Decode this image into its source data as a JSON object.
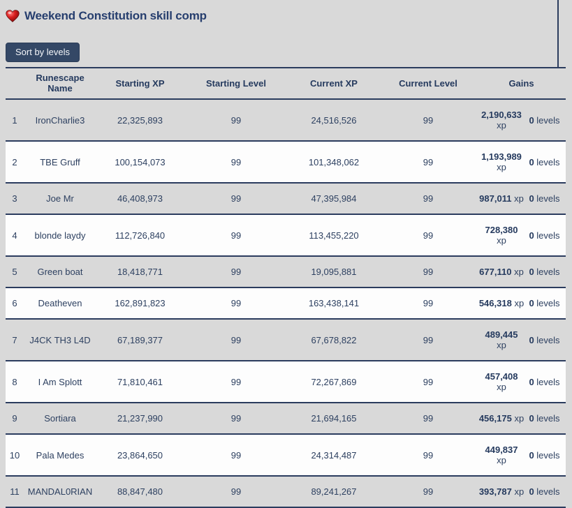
{
  "page": {
    "title": "Weekend Constitution skill comp",
    "heart_icon": "glossy-red-heart",
    "sort_button_label": "Sort by levels",
    "colors": {
      "background": "#d9d9d9",
      "row_alt": "#fdfdfd",
      "navy_line": "#2b3c5e",
      "title_text": "#263e6e",
      "button_bg": "#344866",
      "heart_red": "#c41414"
    }
  },
  "table": {
    "columns": {
      "rank": "",
      "name": "Runescape Name",
      "starting_xp": "Starting XP",
      "starting_level": "Starting Level",
      "current_xp": "Current XP",
      "current_level": "Current Level",
      "gains": "Gains"
    },
    "rows": [
      {
        "rank": "1",
        "name": "IronCharlie3",
        "starting_xp": "22,325,893",
        "starting_level": "99",
        "current_xp": "24,516,526",
        "current_level": "99",
        "gain_xp": "2,190,633",
        "gain_xp_unit": "xp",
        "gain_xp_wrap": true,
        "gain_levels": "0",
        "gain_levels_unit": "levels"
      },
      {
        "rank": "2",
        "name": "TBE Gruff",
        "starting_xp": "100,154,073",
        "starting_level": "99",
        "current_xp": "101,348,062",
        "current_level": "99",
        "gain_xp": "1,193,989",
        "gain_xp_unit": "xp",
        "gain_xp_wrap": true,
        "gain_levels": "0",
        "gain_levels_unit": "levels"
      },
      {
        "rank": "3",
        "name": "Joe Mr",
        "starting_xp": "46,408,973",
        "starting_level": "99",
        "current_xp": "47,395,984",
        "current_level": "99",
        "gain_xp": "987,011",
        "gain_xp_unit": "xp",
        "gain_xp_wrap": false,
        "gain_levels": "0",
        "gain_levels_unit": "levels"
      },
      {
        "rank": "4",
        "name": "blonde laydy",
        "starting_xp": "112,726,840",
        "starting_level": "99",
        "current_xp": "113,455,220",
        "current_level": "99",
        "gain_xp": "728,380",
        "gain_xp_unit": "xp",
        "gain_xp_wrap": true,
        "gain_levels": "0",
        "gain_levels_unit": "levels"
      },
      {
        "rank": "5",
        "name": "Green boat",
        "starting_xp": "18,418,771",
        "starting_level": "99",
        "current_xp": "19,095,881",
        "current_level": "99",
        "gain_xp": "677,110",
        "gain_xp_unit": "xp",
        "gain_xp_wrap": false,
        "gain_levels": "0",
        "gain_levels_unit": "levels"
      },
      {
        "rank": "6",
        "name": "Deatheven",
        "starting_xp": "162,891,823",
        "starting_level": "99",
        "current_xp": "163,438,141",
        "current_level": "99",
        "gain_xp": "546,318",
        "gain_xp_unit": "xp",
        "gain_xp_wrap": false,
        "gain_levels": "0",
        "gain_levels_unit": "levels"
      },
      {
        "rank": "7",
        "name": "J4CK TH3 L4D",
        "starting_xp": "67,189,377",
        "starting_level": "99",
        "current_xp": "67,678,822",
        "current_level": "99",
        "gain_xp": "489,445",
        "gain_xp_unit": "xp",
        "gain_xp_wrap": true,
        "gain_levels": "0",
        "gain_levels_unit": "levels"
      },
      {
        "rank": "8",
        "name": "I Am Splott",
        "starting_xp": "71,810,461",
        "starting_level": "99",
        "current_xp": "72,267,869",
        "current_level": "99",
        "gain_xp": "457,408",
        "gain_xp_unit": "xp",
        "gain_xp_wrap": true,
        "gain_levels": "0",
        "gain_levels_unit": "levels"
      },
      {
        "rank": "9",
        "name": "Sortiara",
        "starting_xp": "21,237,990",
        "starting_level": "99",
        "current_xp": "21,694,165",
        "current_level": "99",
        "gain_xp": "456,175",
        "gain_xp_unit": "xp",
        "gain_xp_wrap": false,
        "gain_levels": "0",
        "gain_levels_unit": "levels"
      },
      {
        "rank": "10",
        "name": "Pala Medes",
        "starting_xp": "23,864,650",
        "starting_level": "99",
        "current_xp": "24,314,487",
        "current_level": "99",
        "gain_xp": "449,837",
        "gain_xp_unit": "xp",
        "gain_xp_wrap": true,
        "gain_levels": "0",
        "gain_levels_unit": "levels"
      },
      {
        "rank": "11",
        "name": "MANDAL0RIAN",
        "starting_xp": "88,847,480",
        "starting_level": "99",
        "current_xp": "89,241,267",
        "current_level": "99",
        "gain_xp": "393,787",
        "gain_xp_unit": "xp",
        "gain_xp_wrap": false,
        "gain_levels": "0",
        "gain_levels_unit": "levels"
      }
    ]
  }
}
